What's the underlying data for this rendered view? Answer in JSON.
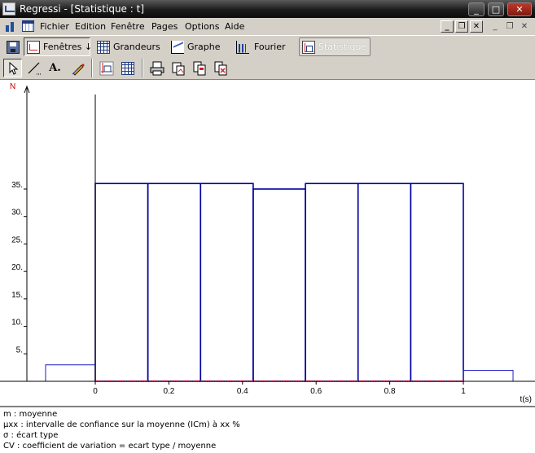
{
  "window": {
    "title": "Regressi  - [Statistique : t]",
    "buttons": {
      "minimize": "_",
      "maximize": "□",
      "close": "✕"
    }
  },
  "menu": {
    "items": [
      "Fichier",
      "Edition",
      "Fenêtre",
      "Pages",
      "Options",
      "Aide"
    ],
    "mdi": {
      "minimize": "_",
      "restore": "❐",
      "close": "✕"
    }
  },
  "nav_toolbar": {
    "fenetres": "Fenêtres ↓",
    "grandeurs": "Grandeurs",
    "graphe": "Graphe",
    "fourier": "Fourier",
    "statistique": "Statistique"
  },
  "tools": {
    "pointer": "pointer-icon",
    "line": "line-tool-icon",
    "text": "A.",
    "pencil": "pencil-icon",
    "chart_settings": "chart-settings-icon",
    "grid": "grid-icon",
    "print": "print-icon",
    "copy": "copy-icon",
    "page_copy": "page-copy-icon",
    "page_close": "page-close-icon"
  },
  "chart_data": {
    "type": "bar",
    "ylabel": "N",
    "xlabel": "t(s)",
    "x_ticks": [
      "0",
      "0.2",
      "0.4",
      "0.6",
      "0.8",
      "1"
    ],
    "x_tick_values": [
      0,
      0.2,
      0.4,
      0.6,
      0.8,
      1
    ],
    "y_ticks": [
      "5.",
      "10.",
      "15.",
      "20.",
      "25.",
      "30.",
      "35."
    ],
    "y_tick_values": [
      5,
      10,
      15,
      20,
      25,
      30,
      35
    ],
    "xlim": [
      -0.135,
      1.17
    ],
    "ylim": [
      0,
      37
    ],
    "bins": [
      {
        "x0": -0.135,
        "x1": 0.0,
        "value": 3,
        "color": "#2020c0",
        "bold": false
      },
      {
        "x0": 0.0,
        "x1": 0.143,
        "value": 36,
        "color": "#0000a0",
        "bold": true
      },
      {
        "x0": 0.143,
        "x1": 0.286,
        "value": 36,
        "color": "#0000a0",
        "bold": true
      },
      {
        "x0": 0.286,
        "x1": 0.429,
        "value": 36,
        "color": "#0000a0",
        "bold": true
      },
      {
        "x0": 0.429,
        "x1": 0.571,
        "value": 35,
        "color": "#0000a0",
        "bold": true
      },
      {
        "x0": 0.571,
        "x1": 0.714,
        "value": 36,
        "color": "#0000a0",
        "bold": true
      },
      {
        "x0": 0.714,
        "x1": 0.857,
        "value": 36,
        "color": "#0000a0",
        "bold": true
      },
      {
        "x0": 0.857,
        "x1": 1.0,
        "value": 36,
        "color": "#0000a0",
        "bold": true
      },
      {
        "x0": 1.0,
        "x1": 1.135,
        "value": 2,
        "color": "#2020c0",
        "bold": false
      }
    ],
    "baseline_color": "#c00040",
    "grid": false
  },
  "legend": {
    "lines": [
      "m : moyenne",
      "µxx : intervalle de confiance sur la moyenne (ICm) à xx %",
      "σ : écart type",
      "CV : coefficient de variation  = ecart type / moyenne"
    ]
  }
}
